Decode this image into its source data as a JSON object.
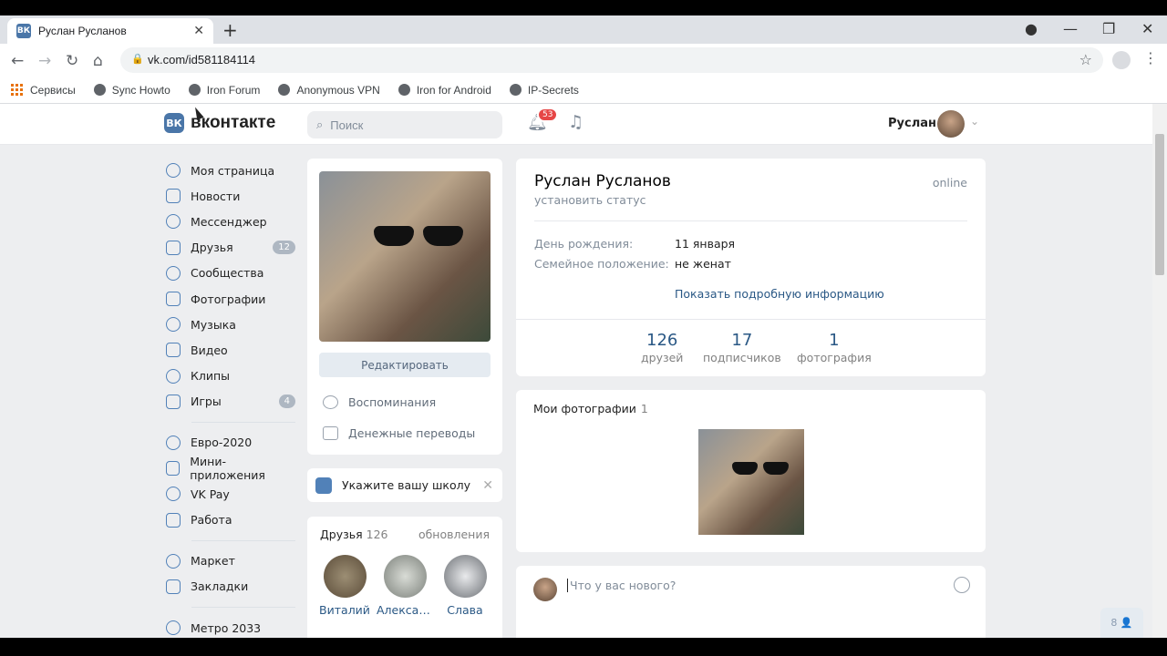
{
  "browser": {
    "tab_title": "Руслан Русланов",
    "tab_favicon": "ВК",
    "url": "vk.com/id581184114",
    "bookmarks": [
      {
        "label": "Сервисы"
      },
      {
        "label": "Sync Howto"
      },
      {
        "label": "Iron Forum"
      },
      {
        "label": "Anonymous VPN"
      },
      {
        "label": "Iron for Android"
      },
      {
        "label": "IP-Secrets"
      }
    ]
  },
  "header": {
    "logo_mark": "ВК",
    "logo_text": "вконтакте",
    "search_placeholder": "Поиск",
    "notifications_count": "53",
    "user_name": "Руслан"
  },
  "menu": {
    "items": [
      {
        "label": "Моя страница",
        "icon": "user-icon"
      },
      {
        "label": "Новости",
        "icon": "news-icon"
      },
      {
        "label": "Мессенджер",
        "icon": "chat-icon"
      },
      {
        "label": "Друзья",
        "icon": "friends-icon",
        "count": "12"
      },
      {
        "label": "Сообщества",
        "icon": "communities-icon"
      },
      {
        "label": "Фотографии",
        "icon": "photos-icon"
      },
      {
        "label": "Музыка",
        "icon": "music-icon"
      },
      {
        "label": "Видео",
        "icon": "video-icon"
      },
      {
        "label": "Клипы",
        "icon": "clips-icon"
      },
      {
        "label": "Игры",
        "icon": "games-icon",
        "count": "4"
      }
    ],
    "items2": [
      {
        "label": "Евро-2020",
        "icon": "ball-icon"
      },
      {
        "label": "Мини-приложения",
        "icon": "apps-icon"
      },
      {
        "label": "VK Pay",
        "icon": "pay-icon"
      },
      {
        "label": "Работа",
        "icon": "work-icon"
      }
    ],
    "items3": [
      {
        "label": "Маркет",
        "icon": "market-icon"
      },
      {
        "label": "Закладки",
        "icon": "bookmark-icon"
      }
    ],
    "items4": [
      {
        "label": "Метро 2033",
        "icon": "gamepad-icon"
      }
    ]
  },
  "profile_left": {
    "edit_label": "Редактировать",
    "memories_label": "Воспоминания",
    "transfers_label": "Денежные переводы",
    "school_label": "Укажите вашу школу",
    "friends_title": "Друзья",
    "friends_count": "126",
    "friends_updates": "обновления",
    "friends": [
      {
        "name": "Виталий"
      },
      {
        "name": "Александ..."
      },
      {
        "name": "Слава"
      }
    ]
  },
  "profile": {
    "name": "Руслан Русланов",
    "status": "установить статус",
    "online": "online",
    "birthday_label": "День рождения:",
    "birthday_value": "11 января",
    "relationship_label": "Семейное положение:",
    "relationship_value": "не женат",
    "more_info": "Показать подробную информацию",
    "counters": [
      {
        "num": "126",
        "label": "друзей"
      },
      {
        "num": "17",
        "label": "подписчиков"
      },
      {
        "num": "1",
        "label": "фотография"
      }
    ]
  },
  "photos": {
    "title": "Мои фотографии",
    "count": "1"
  },
  "post": {
    "placeholder": "Что у вас нового?"
  },
  "chat": {
    "label": "8 👤"
  }
}
